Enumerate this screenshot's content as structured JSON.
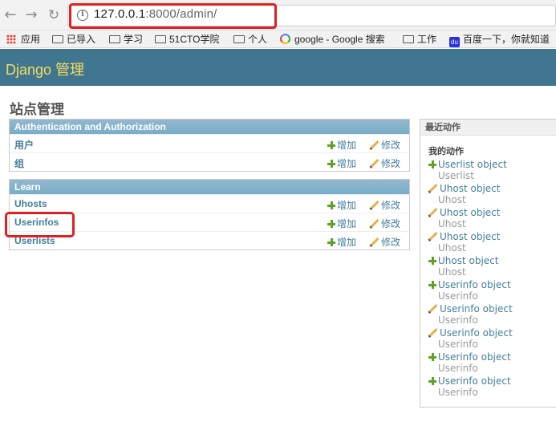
{
  "browser": {
    "url_host": "127.0.0.1",
    "url_rest": ":8000/admin/",
    "bookmarks": [
      {
        "label": "应用",
        "icon": "apps-icon"
      },
      {
        "label": "已导入",
        "icon": "folder-icon"
      },
      {
        "label": "学习",
        "icon": "folder-icon"
      },
      {
        "label": "51CTO学院",
        "icon": "folder-icon"
      },
      {
        "label": "个人",
        "icon": "folder-icon"
      },
      {
        "label": "google - Google 搜索",
        "icon": "google-icon"
      },
      {
        "label": "工作",
        "icon": "folder-icon"
      },
      {
        "label": "百度一下，你就知道",
        "icon": "baidu-icon"
      }
    ]
  },
  "header": {
    "title": "Django 管理"
  },
  "page": {
    "title": "站点管理"
  },
  "modules": [
    {
      "title": "Authentication and Authorization",
      "rows": [
        {
          "name": "用户",
          "add": "增加",
          "change": "修改"
        },
        {
          "name": "组",
          "add": "增加",
          "change": "修改"
        }
      ]
    },
    {
      "title": "Learn",
      "rows": [
        {
          "name": "Uhosts",
          "add": "增加",
          "change": "修改"
        },
        {
          "name": "Userinfos",
          "add": "增加",
          "change": "修改"
        },
        {
          "name": "Userlists",
          "add": "增加",
          "change": "修改"
        }
      ]
    }
  ],
  "recent": {
    "title": "最近动作",
    "subtitle": "我的动作",
    "actions": [
      {
        "icon": "plus-icon",
        "object": "Userlist object",
        "type": "Userlist"
      },
      {
        "icon": "pencil-icon",
        "object": "Uhost object",
        "type": "Uhost"
      },
      {
        "icon": "pencil-icon",
        "object": "Uhost object",
        "type": "Uhost"
      },
      {
        "icon": "pencil-icon",
        "object": "Uhost object",
        "type": "Uhost"
      },
      {
        "icon": "plus-icon",
        "object": "Uhost object",
        "type": "Uhost"
      },
      {
        "icon": "plus-icon",
        "object": "Userinfo object",
        "type": "Userinfo"
      },
      {
        "icon": "pencil-icon",
        "object": "Userinfo object",
        "type": "Userinfo"
      },
      {
        "icon": "pencil-icon",
        "object": "Userinfo object",
        "type": "Userinfo"
      },
      {
        "icon": "plus-icon",
        "object": "Userinfo object",
        "type": "Userinfo"
      },
      {
        "icon": "plus-icon",
        "object": "Userinfo object",
        "type": "Userinfo"
      }
    ]
  }
}
